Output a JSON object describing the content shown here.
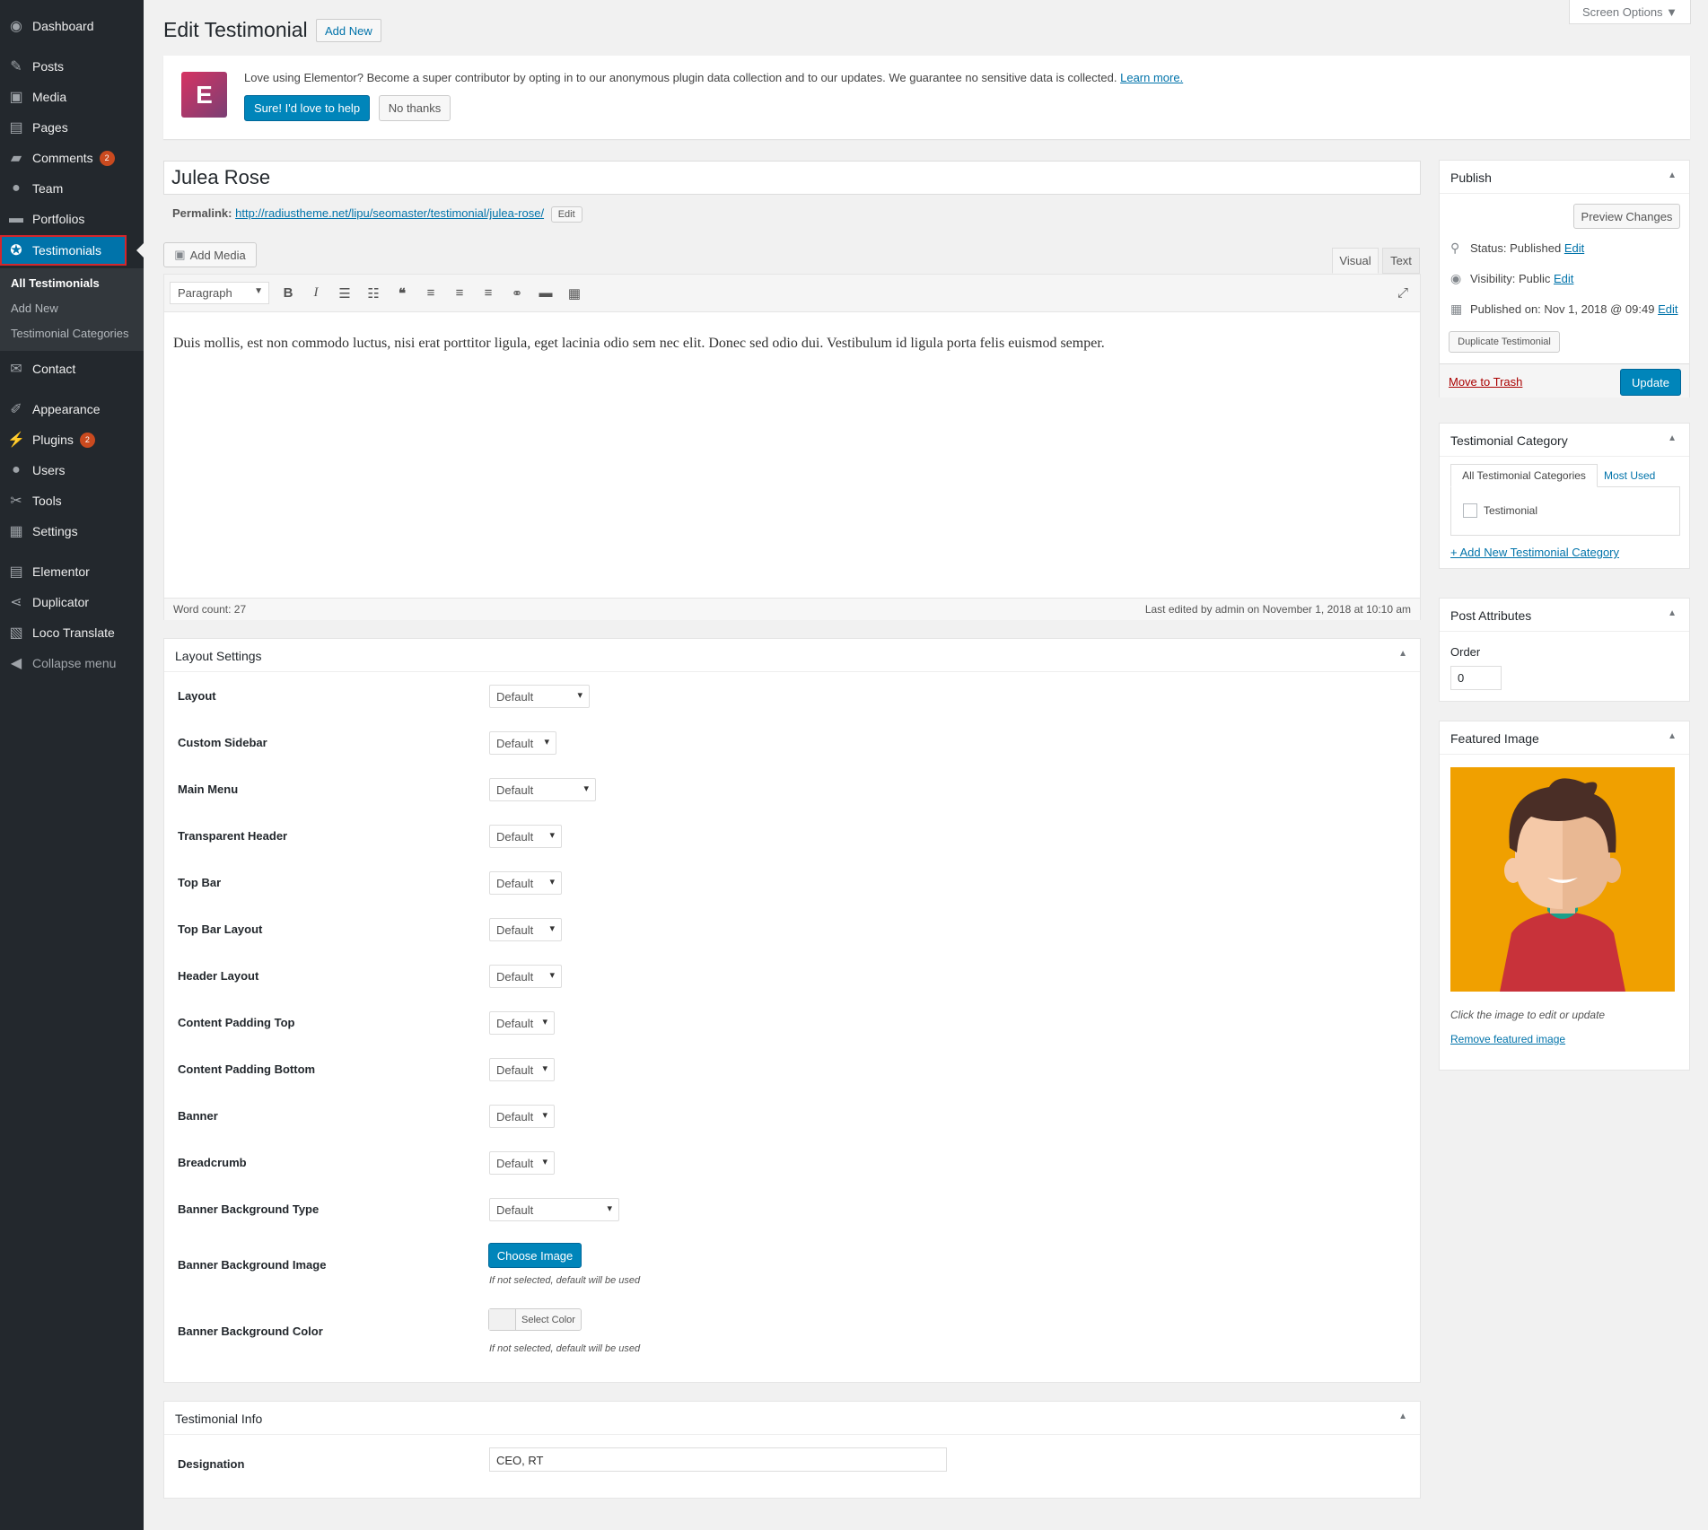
{
  "menu": [
    {
      "key": "dashboard",
      "label": "Dashboard",
      "icon": "dashboard-icon",
      "glyph": "◉"
    },
    {
      "key": "posts",
      "label": "Posts",
      "icon": "pin-icon",
      "glyph": "✎"
    },
    {
      "key": "media",
      "label": "Media",
      "icon": "media-icon",
      "glyph": "▣"
    },
    {
      "key": "pages",
      "label": "Pages",
      "icon": "pages-icon",
      "glyph": "▤"
    },
    {
      "key": "comments",
      "label": "Comments",
      "badge": "2",
      "icon": "comments-icon",
      "glyph": "▰"
    },
    {
      "key": "team",
      "label": "Team",
      "icon": "team-icon",
      "glyph": "●"
    },
    {
      "key": "portfolios",
      "label": "Portfolios",
      "icon": "folder-icon",
      "glyph": "▬"
    },
    {
      "key": "testimonials",
      "label": "Testimonials",
      "icon": "testimonial-icon",
      "glyph": "✪"
    },
    {
      "key": "contact",
      "label": "Contact",
      "icon": "mail-icon",
      "glyph": "✉"
    },
    {
      "key": "appearance",
      "label": "Appearance",
      "icon": "brush-icon",
      "glyph": "✐"
    },
    {
      "key": "plugins",
      "label": "Plugins",
      "badge": "2",
      "icon": "plugin-icon",
      "glyph": "⚡"
    },
    {
      "key": "users",
      "label": "Users",
      "icon": "user-icon",
      "glyph": "●"
    },
    {
      "key": "tools",
      "label": "Tools",
      "icon": "wrench-icon",
      "glyph": "✂"
    },
    {
      "key": "settings",
      "label": "Settings",
      "icon": "settings-icon",
      "glyph": "▦"
    },
    {
      "key": "elementor",
      "label": "Elementor",
      "icon": "elementor-icon",
      "glyph": "▤"
    },
    {
      "key": "duplicator",
      "label": "Duplicator",
      "icon": "share-icon",
      "glyph": "⋖"
    },
    {
      "key": "loco",
      "label": "Loco Translate",
      "icon": "translate-icon",
      "glyph": "▧"
    },
    {
      "key": "collapse",
      "label": "Collapse menu",
      "icon": "collapse-icon",
      "glyph": "◀"
    }
  ],
  "submenu": [
    "All Testimonials",
    "Add New",
    "Testimonial Categories"
  ],
  "screen_options": "Screen Options ▼",
  "page_title": "Edit Testimonial",
  "add_new": "Add New",
  "notice": {
    "logo": "E",
    "text": "Love using Elementor? Become a super contributor by opting in to our anonymous plugin data collection and to our updates. We guarantee no sensitive data is collected.",
    "learn_more": "Learn more.",
    "yes": "Sure! I'd love to help",
    "no": "No thanks"
  },
  "post_title": "Julea Rose",
  "permalink": {
    "label": "Permalink:",
    "url": "http://radiustheme.net/lipu/seomaster/testimonial/julea-rose/",
    "edit": "Edit"
  },
  "editor": {
    "add_media": "Add Media",
    "tab_visual": "Visual",
    "tab_text": "Text",
    "format": "Paragraph",
    "content": "Duis mollis, est non commodo luctus, nisi erat porttitor ligula, eget lacinia odio sem nec elit. Donec sed odio dui. Vestibulum id ligula porta felis euismod semper.",
    "word_count": "Word count: 27",
    "last_edited": "Last edited by admin on November 1, 2018 at 10:10 am"
  },
  "layout_settings": {
    "title": "Layout Settings",
    "rows": [
      {
        "label": "Layout",
        "value": "Default"
      },
      {
        "label": "Custom Sidebar",
        "value": "Default"
      },
      {
        "label": "Main Menu",
        "value": "Default"
      },
      {
        "label": "Transparent Header",
        "value": "Default"
      },
      {
        "label": "Top Bar",
        "value": "Default"
      },
      {
        "label": "Top Bar Layout",
        "value": "Default"
      },
      {
        "label": "Header Layout",
        "value": "Default"
      },
      {
        "label": "Content Padding Top",
        "value": "Default"
      },
      {
        "label": "Content Padding Bottom",
        "value": "Default"
      },
      {
        "label": "Banner",
        "value": "Default"
      },
      {
        "label": "Breadcrumb",
        "value": "Default"
      },
      {
        "label": "Banner Background Type",
        "value": "Default"
      }
    ],
    "bg_image_label": "Banner Background Image",
    "choose_image": "Choose Image",
    "bg_hint": "If not selected, default will be used",
    "bg_color_label": "Banner Background Color",
    "select_color": "Select Color",
    "color_hint": "If not selected, default will be used"
  },
  "testimonial_info": {
    "title": "Testimonial Info",
    "designation_label": "Designation",
    "designation_value": "CEO, RT"
  },
  "publish": {
    "title": "Publish",
    "preview": "Preview Changes",
    "status_label": "Status:",
    "status": "Published",
    "visibility_label": "Visibility:",
    "visibility": "Public",
    "published_label": "Published on:",
    "published": "Nov 1, 2018 @ 09:49",
    "edit": "Edit",
    "duplicate": "Duplicate Testimonial",
    "trash": "Move to Trash",
    "update": "Update"
  },
  "category": {
    "title": "Testimonial Category",
    "tab_all": "All Testimonial Categories",
    "tab_most": "Most Used",
    "item": "Testimonial",
    "add_new": "+ Add New Testimonial Category"
  },
  "attributes": {
    "title": "Post Attributes",
    "order_label": "Order",
    "order_value": "0"
  },
  "featured": {
    "title": "Featured Image",
    "hint": "Click the image to edit or update",
    "remove": "Remove featured image"
  },
  "colors": {
    "accent": "#0073aa",
    "sidebar": "#23282d",
    "featured_bg": "#f0a000"
  }
}
